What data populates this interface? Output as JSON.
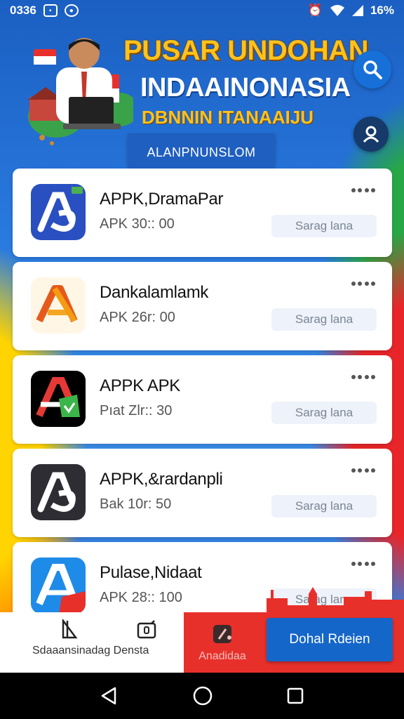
{
  "status_bar": {
    "time": "0336",
    "battery": "16%"
  },
  "banner": {
    "title": "PUSAR UNDOHAN",
    "subtitle1": "INDAAINONASIA",
    "subtitle2": "DBNNIN ITANAAIJU",
    "tab_label": "ALANPNUNSLOM"
  },
  "apps": [
    {
      "name": "APPK,DramaPar",
      "meta": "APK 30:: 00",
      "action": "Sarag lana",
      "icon": "a-logo-blue-icon",
      "colors": [
        "#2a4fc1",
        "#ffffff"
      ]
    },
    {
      "name": "Dankalamlamk",
      "meta": "APK 26r: 00",
      "action": "Sarag lana",
      "icon": "a-logo-orange-icon",
      "colors": [
        "#fff6e6",
        "#f39c12"
      ]
    },
    {
      "name": "APPK APK",
      "meta": "Pıat Zlr:: 30",
      "action": "Sarag lana",
      "icon": "a-logo-flag-icon",
      "colors": [
        "#000000",
        "#e53935"
      ]
    },
    {
      "name": "APPK,&rardanpli",
      "meta": "Bak 10r: 50",
      "action": "Sarag lana",
      "icon": "a-logo-dark-icon",
      "colors": [
        "#2d2d33",
        "#ffffff"
      ]
    },
    {
      "name": "Pulase,Nidaat",
      "meta": "APK 28:: 100",
      "action": "Sarag lana",
      "icon": "a-logo-sky-icon",
      "colors": [
        "#1f8be8",
        "#ffffff"
      ]
    }
  ],
  "bottom_nav": {
    "left_label": "Sdaaansinadag Densta",
    "center_label": "Anadidaa",
    "cta_label": "Dohal Rdeien"
  },
  "colors": {
    "primary": "#1566c9",
    "accent_red": "#e8302b",
    "banner_gold": "#ffc21a"
  }
}
